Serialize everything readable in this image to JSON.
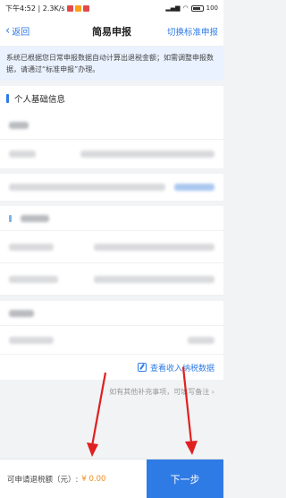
{
  "status_bar": {
    "time_text": "下午4:52 | 2.3K/s",
    "battery": "100"
  },
  "nav": {
    "back_label": "返回",
    "title": "简易申报",
    "switch_label": "切换标准申报"
  },
  "notice": {
    "text": "系统已根据您日常申报数据自动计算出退税金额；如需调整申报数据，请通过“标准申报”办理。"
  },
  "section": {
    "title": "个人基础信息"
  },
  "links": {
    "view_income": "查看收入纳税数据"
  },
  "hint": {
    "text": "如有其他补充事项，可填写备注"
  },
  "footer": {
    "label": "可申请退税额（元）:",
    "amount": "¥ 0.00",
    "next_label": "下一步"
  },
  "colors": {
    "accent": "#2f7be5",
    "amount": "#f08c1a",
    "arrow": "#e02020"
  }
}
